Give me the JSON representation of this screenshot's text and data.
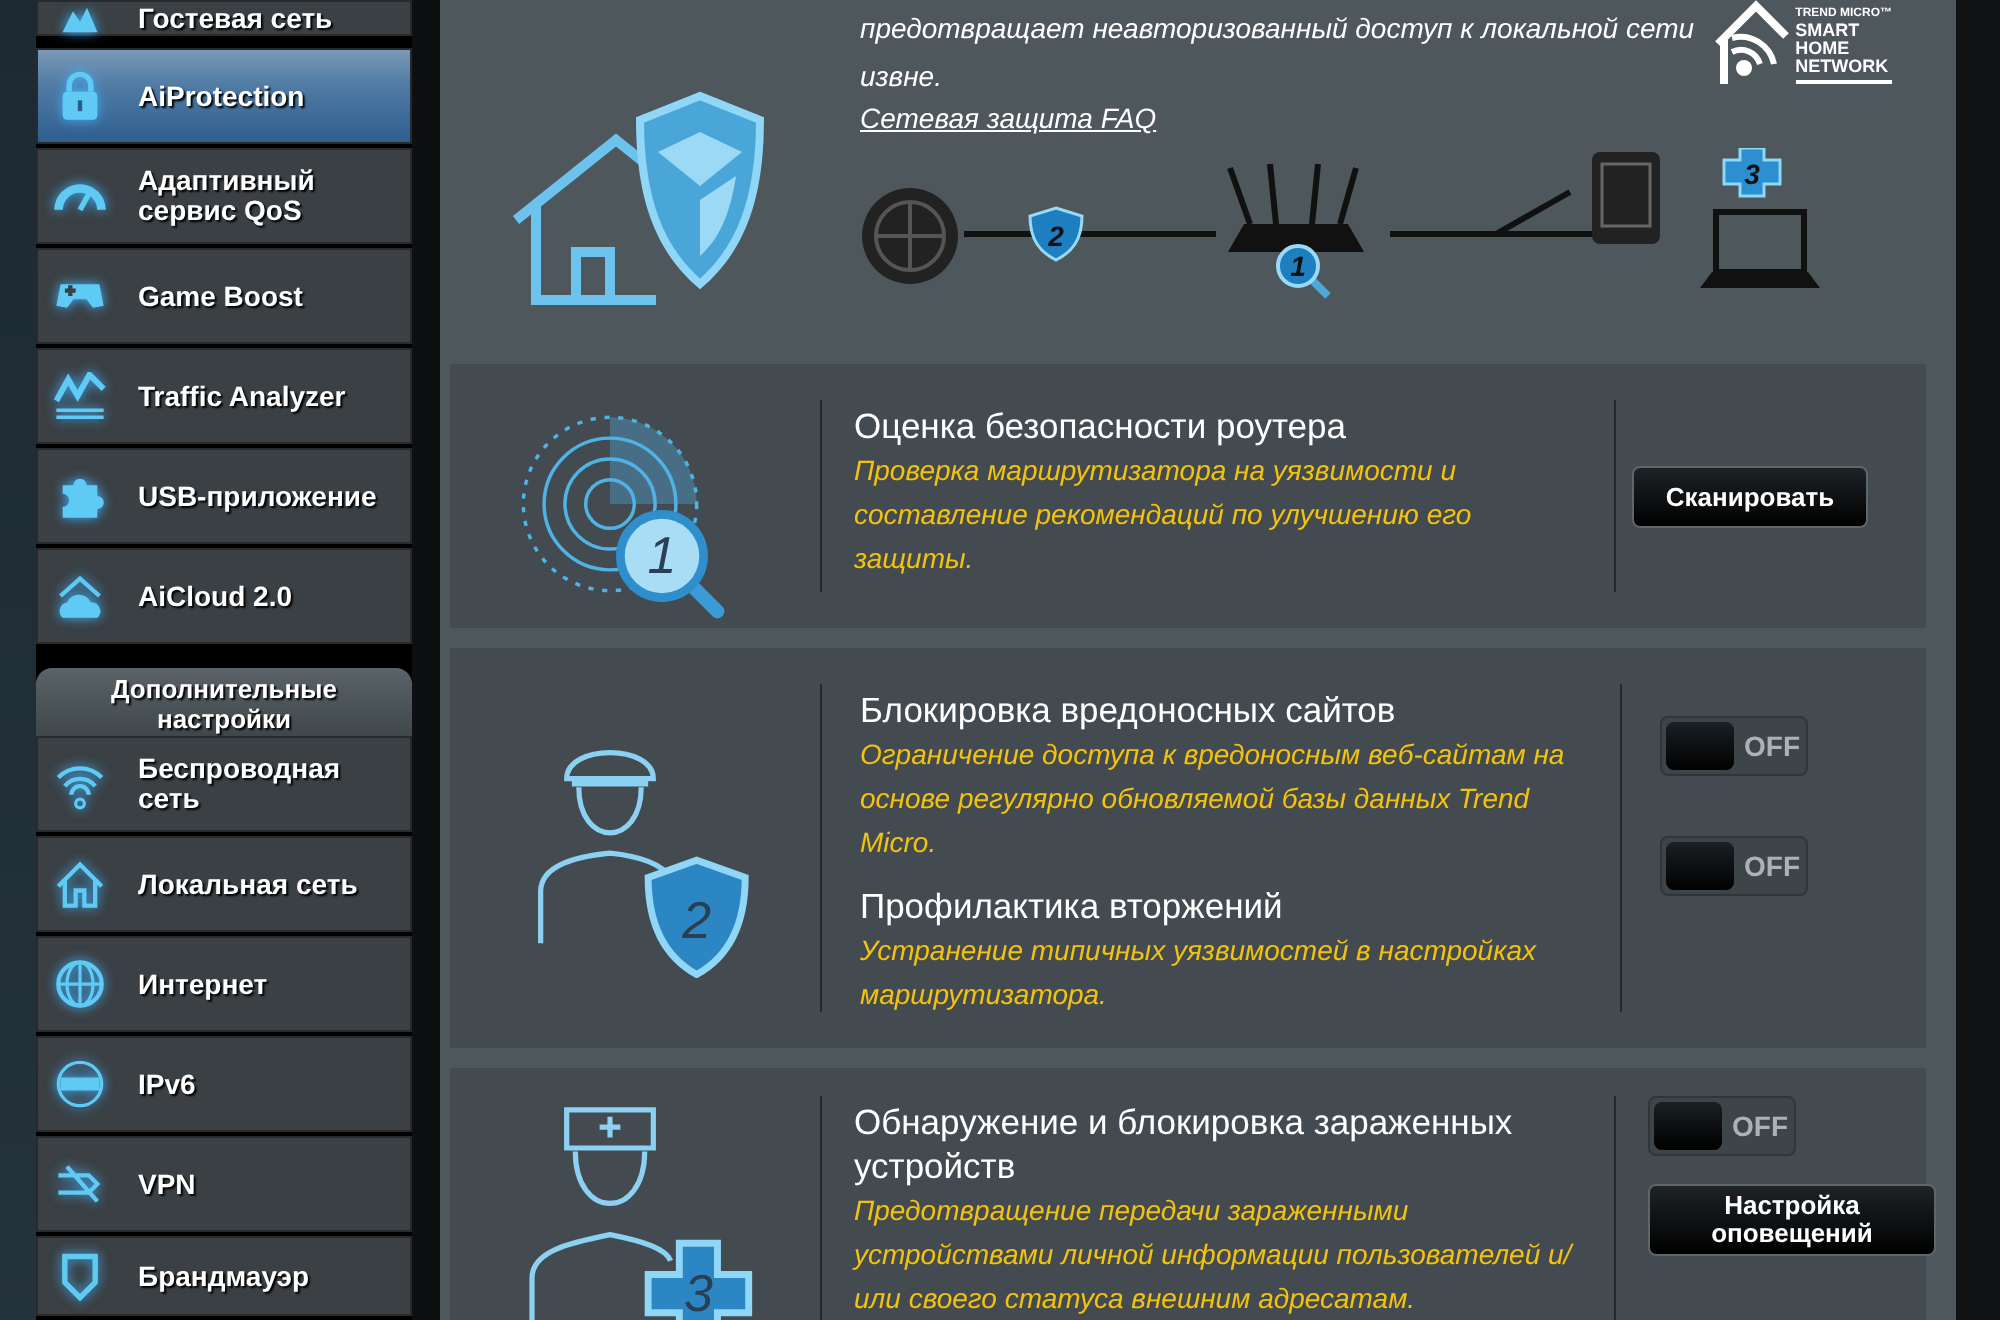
{
  "sidebar": {
    "items": [
      {
        "label": "Гостевая сеть",
        "selected": false
      },
      {
        "label": "AiProtection",
        "selected": true
      },
      {
        "label": "Адаптивный сервис QoS",
        "selected": false
      },
      {
        "label": "Game Boost",
        "selected": false
      },
      {
        "label": "Traffic Analyzer",
        "selected": false
      },
      {
        "label": "USB-приложение",
        "selected": false
      },
      {
        "label": "AiCloud 2.0",
        "selected": false
      }
    ],
    "section_header": "Дополнительные настройки",
    "advanced_items": [
      {
        "label": "Беспроводная сеть",
        "selected": false
      },
      {
        "label": "Локальная сеть",
        "selected": false
      },
      {
        "label": "Интернет",
        "selected": false
      },
      {
        "label": "IPv6",
        "selected": false
      },
      {
        "label": "VPN",
        "selected": false
      },
      {
        "label": "Брандмауэр",
        "selected": false
      }
    ]
  },
  "intro": {
    "text": "предотвращает неавторизованный доступ к локальной сети извне.",
    "link": "Сетевая защита FAQ"
  },
  "logo": {
    "brand": "TREND MICRO™",
    "lines": [
      "SMART",
      "HOME",
      "NETWORK"
    ]
  },
  "diagram": {
    "badges": [
      "2",
      "1",
      "3"
    ]
  },
  "cards": [
    {
      "badge": "1",
      "features": [
        {
          "title": "Оценка безопасности роутера",
          "description": "Проверка маршрутизатора на уязвимости и составление рекомендаций по улучшению его защиты."
        }
      ],
      "controls": [
        {
          "kind": "button",
          "label": "Сканировать"
        }
      ]
    },
    {
      "badge": "2",
      "features": [
        {
          "title": "Блокировка вредоносных сайтов",
          "description": "Ограничение доступа к вредоносным веб-сайтам на основе регулярно обновляемой базы данных Trend Micro."
        },
        {
          "title": "Профилактика вторжений",
          "description": "Устранение типичных уязвимостей в настройках маршрутизатора."
        }
      ],
      "controls": [
        {
          "kind": "toggle",
          "on": false,
          "label": "OFF"
        },
        {
          "kind": "toggle",
          "on": false,
          "label": "OFF"
        }
      ]
    },
    {
      "badge": "3",
      "features": [
        {
          "title": "Обнаружение и блокировка зараженных устройств",
          "description": "Предотвращение передачи зараженными устройствами личной информации пользователей и/или своего статуса внешним адресатам."
        }
      ],
      "controls": [
        {
          "kind": "toggle",
          "on": false,
          "label": "OFF"
        },
        {
          "kind": "button",
          "label": "Настройка оповещений"
        }
      ]
    }
  ]
}
